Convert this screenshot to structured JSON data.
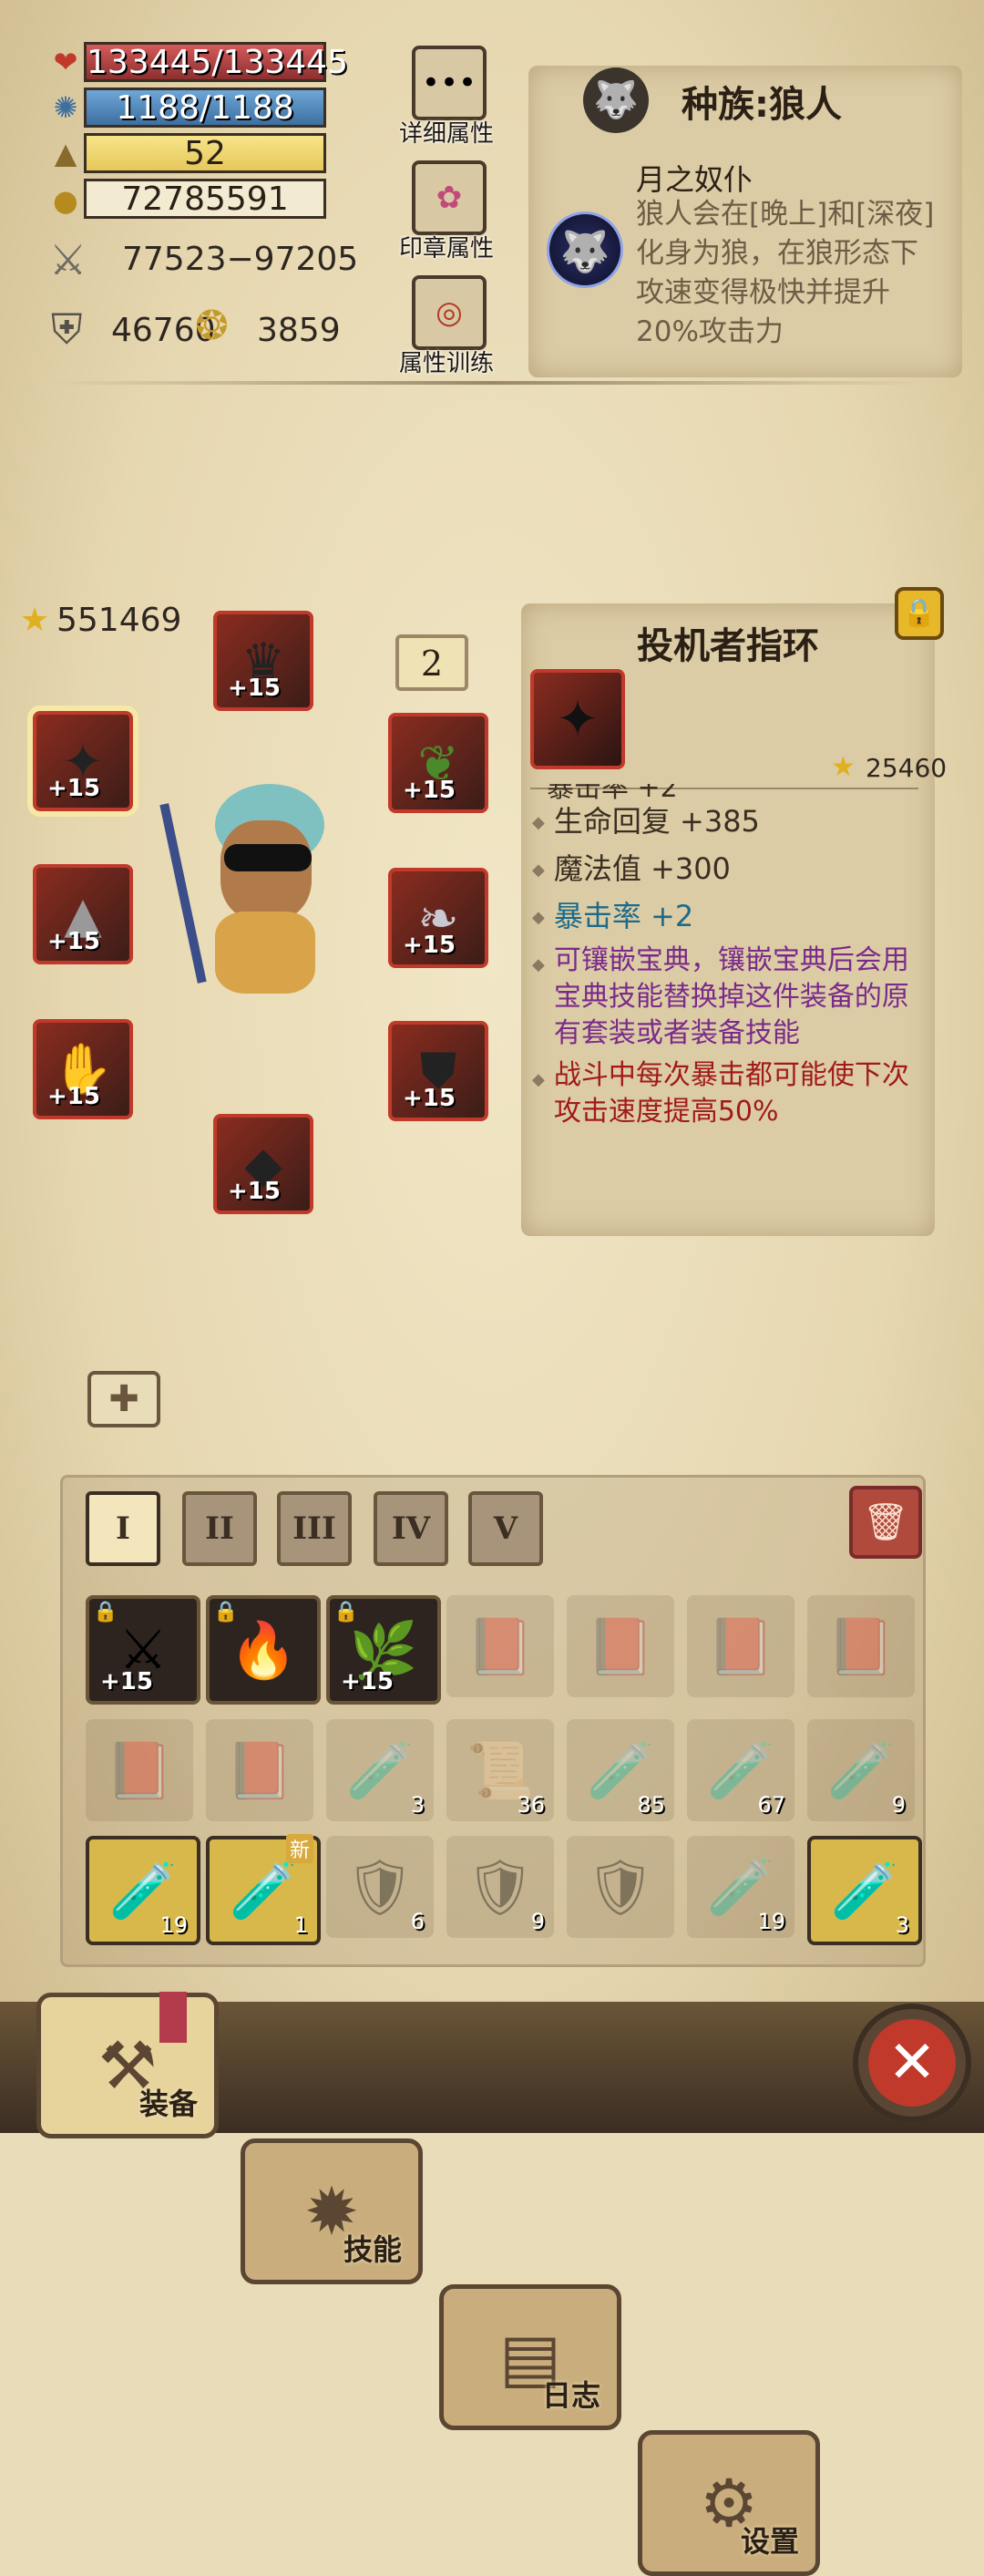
{
  "stats": {
    "hp": "133445/133445",
    "mp": "1188/1188",
    "level": "52",
    "gold": "72785591",
    "attack": "77523−97205",
    "defense": "46760",
    "speed": "3859"
  },
  "side_buttons": {
    "detail": "详细属性",
    "seal": "印章属性",
    "training": "属性训练"
  },
  "race": {
    "title": "种族:狼人",
    "skill_name": "月之奴仆",
    "skill_desc": "狼人会在[晚上]和[深夜]化身为狼，在狼形态下攻速变得极快并提升20%攻击力"
  },
  "equipment": {
    "score": "551469",
    "badge": "2",
    "slots": [
      {
        "name": "helmet",
        "plus": "+15",
        "icon": "crown-icon"
      },
      {
        "name": "weapon",
        "plus": "+15",
        "icon": "claw-icon"
      },
      {
        "name": "amulet",
        "plus": "+15",
        "icon": "amulet-icon"
      },
      {
        "name": "offhand",
        "plus": "+15",
        "icon": "spike-icon"
      },
      {
        "name": "wings",
        "plus": "+15",
        "icon": "wings-icon"
      },
      {
        "name": "gloves",
        "plus": "+15",
        "icon": "gauntlet-icon"
      },
      {
        "name": "armor",
        "plus": "+15",
        "icon": "armor-icon"
      },
      {
        "name": "boots",
        "plus": "+15",
        "icon": "boots-icon"
      }
    ]
  },
  "item_panel": {
    "title": "投机者指环",
    "score": "25460",
    "partial_line": "暴击率 +2",
    "attrs": [
      {
        "text": "生命回复 +385",
        "color": "#3b2e22"
      },
      {
        "text": "魔法值 +300",
        "color": "#3b2e22"
      },
      {
        "text": "暴击率 +2",
        "color": "#1d6a8a"
      },
      {
        "text": "可镶嵌宝典，镶嵌宝典后会用宝典技能替换掉这件装备的原有套装或者装备技能",
        "color": "#7a2a8a"
      },
      {
        "text": "战斗中每次暴击都可能使下次攻击速度提高50%",
        "color": "#a11a1a"
      }
    ]
  },
  "tabs": [
    "I",
    "II",
    "III",
    "IV",
    "V"
  ],
  "inventory": [
    {
      "owned": true,
      "icon": "⚔",
      "plus": "+15",
      "lock": true
    },
    {
      "owned": true,
      "icon": "🔥",
      "lock": true
    },
    {
      "owned": true,
      "icon": "🌿",
      "plus": "+15",
      "lock": true
    },
    {
      "owned": false,
      "icon": "📕"
    },
    {
      "owned": false,
      "icon": "📕"
    },
    {
      "owned": false,
      "icon": "📕"
    },
    {
      "owned": false,
      "icon": "📕"
    },
    {
      "owned": false,
      "icon": "📕"
    },
    {
      "owned": false,
      "icon": "📕"
    },
    {
      "owned": false,
      "icon": "🧪",
      "count": "3"
    },
    {
      "owned": false,
      "icon": "📜",
      "count": "36"
    },
    {
      "owned": false,
      "icon": "🧪",
      "count": "85"
    },
    {
      "owned": false,
      "icon": "🧪",
      "count": "67"
    },
    {
      "owned": false,
      "icon": "🧪",
      "count": "9"
    },
    {
      "owned": true,
      "icon": "🧪",
      "count": "19",
      "bright": true
    },
    {
      "owned": true,
      "icon": "🧪",
      "count": "1",
      "new": "新",
      "bright": true
    },
    {
      "owned": false,
      "icon": "🛡",
      "count": "6"
    },
    {
      "owned": false,
      "icon": "🛡",
      "count": "9"
    },
    {
      "owned": false,
      "icon": "🛡"
    },
    {
      "owned": false,
      "icon": "🧪",
      "count": "19"
    },
    {
      "owned": true,
      "icon": "🧪",
      "count": "3",
      "bright": true
    }
  ],
  "nav": {
    "equip": "装备",
    "skill": "技能",
    "log": "日志",
    "settings": "设置"
  },
  "colors": {
    "accent": "#c0392b",
    "parchment": "#e9dcb8"
  }
}
